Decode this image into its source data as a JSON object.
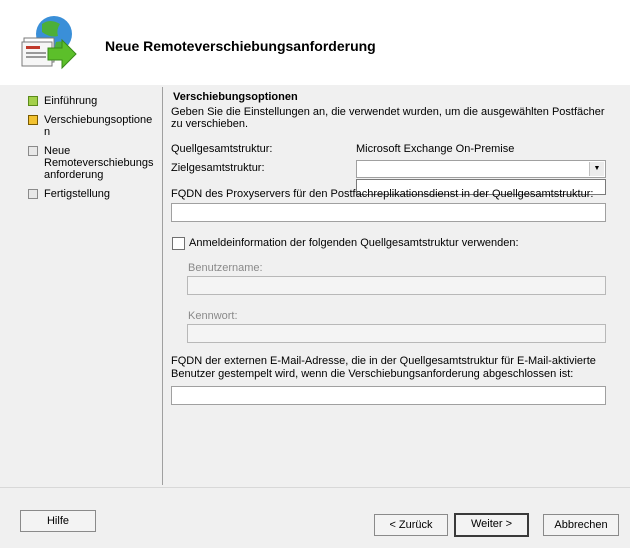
{
  "header": {
    "title": "Neue Remoteverschiebungsanforderung"
  },
  "nav": {
    "items": [
      {
        "label": "Einführung",
        "state": "done"
      },
      {
        "label": "Verschiebungsoptione n",
        "state": "current"
      },
      {
        "label": "Neue Remoteverschiebungs anforderung",
        "state": "pending"
      },
      {
        "label": "Fertigstellung",
        "state": "pending"
      }
    ]
  },
  "section": {
    "title": "Verschiebungsoptionen",
    "description": "Geben Sie die Einstellungen an, die verwendet wurden, um die ausgewählten Postfächer zu verschieben."
  },
  "form": {
    "source_forest_label": "Quellgesamtstruktur:",
    "source_forest_value": "Microsoft Exchange On-Premise",
    "target_forest_label": "Zielgesamtstruktur:",
    "target_forest_value": "",
    "fqdn_proxy_label": "FQDN des Proxyservers für den Postfachreplikationsdienst in der Quellgesamtstruktur:",
    "fqdn_proxy_value": "",
    "use_credentials_label": "Anmeldeinformation der folgenden Quellgesamtstruktur verwenden:",
    "use_credentials_checked": false,
    "username_label": "Benutzername:",
    "username_value": "",
    "password_label": "Kennwort:",
    "password_value": "",
    "fqdn_email_label": "FQDN der externen E-Mail-Adresse, die in der Quellgesamtstruktur für E-Mail-aktivierte Benutzer gestempelt wird, wenn die Verschiebungsanforderung abgeschlossen ist:",
    "fqdn_email_value": ""
  },
  "buttons": {
    "help": "Hilfe",
    "back": "< Zurück",
    "next": "Weiter >",
    "cancel": "Abbrechen"
  }
}
